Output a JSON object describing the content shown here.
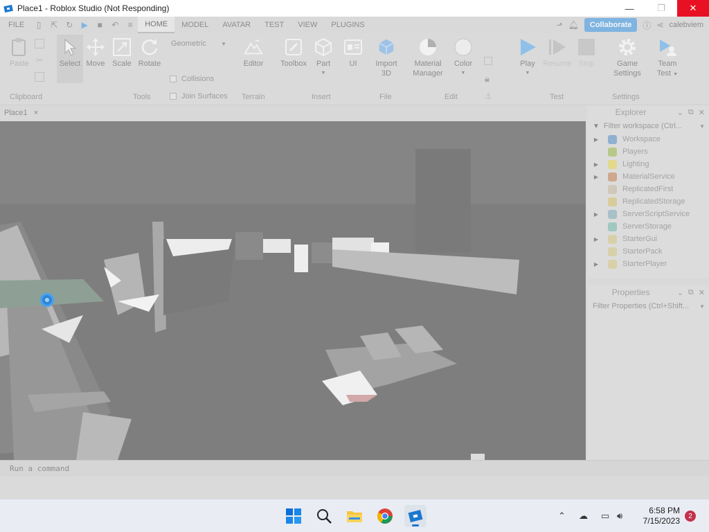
{
  "window": {
    "title": "Place1 - Roblox Studio (Not Responding)"
  },
  "menu": {
    "file": "FILE",
    "tabs": [
      "HOME",
      "MODEL",
      "AVATAR",
      "TEST",
      "VIEW",
      "PLUGINS"
    ],
    "collaborate": "Collaborate",
    "user": "calebviem"
  },
  "ribbon": {
    "paste": "Paste",
    "select": "Select",
    "move": "Move",
    "scale": "Scale",
    "rotate": "Rotate",
    "geometric": "Geometric",
    "collisions": "Collisions",
    "join_surfaces": "Join Surfaces",
    "editor": "Editor",
    "toolbox": "Toolbox",
    "part": "Part",
    "ui": "UI",
    "import3d": [
      "Import",
      "3D"
    ],
    "material_manager": [
      "Material",
      "Manager"
    ],
    "color": "Color",
    "play": "Play",
    "resume": "Resume",
    "stop": "Stop",
    "game_settings": [
      "Game",
      "Settings"
    ],
    "team_test": [
      "Team",
      "Test"
    ],
    "groups": [
      "Clipboard",
      "Tools",
      "Terrain",
      "Insert",
      "File",
      "Edit",
      "Test",
      "Settings"
    ]
  },
  "doc_tab": {
    "label": "Place1",
    "close": "×"
  },
  "explorer": {
    "title": "Explorer",
    "filter": "Filter workspace (Ctrl...",
    "items": [
      {
        "label": "Workspace",
        "expandable": true,
        "color": "#8fb0d0"
      },
      {
        "label": "Players",
        "expandable": false,
        "color": "#b8c88a"
      },
      {
        "label": "Lighting",
        "expandable": true,
        "color": "#e3d98a"
      },
      {
        "label": "MaterialService",
        "expandable": true,
        "color": "#d0a890"
      },
      {
        "label": "ReplicatedFirst",
        "expandable": false,
        "color": "#d0c8b8"
      },
      {
        "label": "ReplicatedStorage",
        "expandable": false,
        "color": "#d8cc9a"
      },
      {
        "label": "ServerScriptService",
        "expandable": true,
        "color": "#a8c0c8"
      },
      {
        "label": "ServerStorage",
        "expandable": false,
        "color": "#a0c8c0"
      },
      {
        "label": "StarterGui",
        "expandable": true,
        "color": "#d8d0a8"
      },
      {
        "label": "StarterPack",
        "expandable": false,
        "color": "#d8d0a8"
      },
      {
        "label": "StarterPlayer",
        "expandable": true,
        "color": "#d8d0a8"
      }
    ]
  },
  "properties": {
    "title": "Properties",
    "filter": "Filter Properties (Ctrl+Shift..."
  },
  "command": {
    "placeholder": "Run a command"
  },
  "taskbar": {
    "time": "6:58 PM",
    "date": "7/15/2023",
    "notifications": "2"
  }
}
